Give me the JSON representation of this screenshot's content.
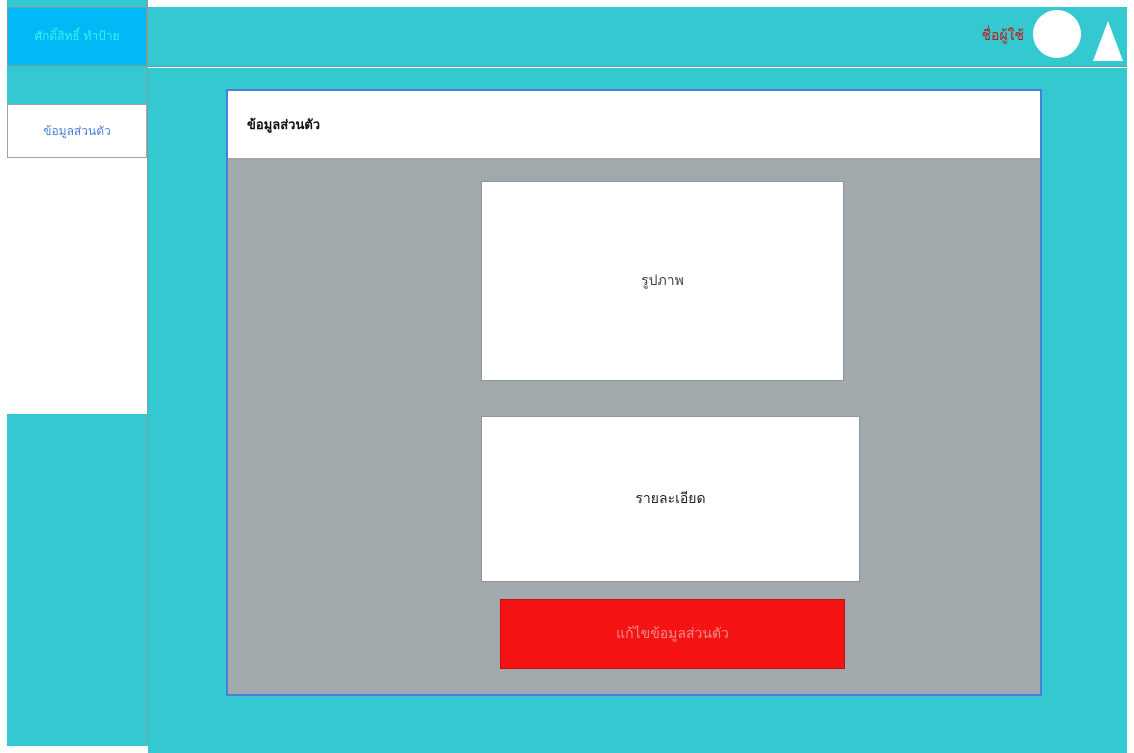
{
  "app": {
    "brand_label": "ศักดิ์สิทธิ์ ทำป้าย"
  },
  "header": {
    "username": "ชื่อผู้ใช้",
    "icons": [
      "avatar-circle",
      "triangle-icon"
    ]
  },
  "sidebar": {
    "items": [
      {
        "label": "ข้อมูลส่วนตัว"
      }
    ]
  },
  "main": {
    "panel_title": "ข้อมูลส่วนตัว",
    "image_label": "รูปภาพ",
    "detail_label": "รายละเอียด",
    "edit_button_label": "แก้ไขข้อมูลส่วนตัว"
  },
  "colors": {
    "background": "#34c9d0",
    "brand": "#02b9f5",
    "panel": "#a2a9ad",
    "button": "#f51313",
    "username": "#c41212"
  }
}
